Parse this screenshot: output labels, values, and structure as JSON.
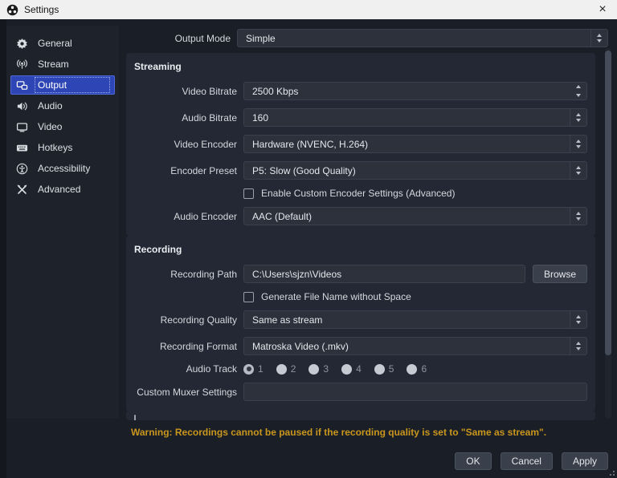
{
  "window": {
    "title": "Settings",
    "close_glyph": "×"
  },
  "sidebar": {
    "selected": "Output",
    "items": [
      {
        "label": "General",
        "icon": "gear-icon"
      },
      {
        "label": "Stream",
        "icon": "broadcast-icon"
      },
      {
        "label": "Output",
        "icon": "output-displays-icon"
      },
      {
        "label": "Audio",
        "icon": "speaker-icon"
      },
      {
        "label": "Video",
        "icon": "monitor-icon"
      },
      {
        "label": "Hotkeys",
        "icon": "keyboard-icon"
      },
      {
        "label": "Accessibility",
        "icon": "accessibility-icon"
      },
      {
        "label": "Advanced",
        "icon": "tools-icon"
      }
    ]
  },
  "output_mode": {
    "label": "Output Mode",
    "value": "Simple"
  },
  "streaming": {
    "title": "Streaming",
    "video_bitrate": {
      "label": "Video Bitrate",
      "value": "2500 Kbps"
    },
    "audio_bitrate": {
      "label": "Audio Bitrate",
      "value": "160"
    },
    "video_encoder": {
      "label": "Video Encoder",
      "value": "Hardware (NVENC, H.264)"
    },
    "encoder_preset": {
      "label": "Encoder Preset",
      "value": "P5: Slow (Good Quality)"
    },
    "custom_encoder_checkbox": {
      "label": "Enable Custom Encoder Settings (Advanced)",
      "checked": false
    },
    "audio_encoder": {
      "label": "Audio Encoder",
      "value": "AAC (Default)"
    }
  },
  "recording": {
    "title": "Recording",
    "path": {
      "label": "Recording Path",
      "value": "C:\\Users\\sjzn\\Videos",
      "browse_label": "Browse"
    },
    "no_space_checkbox": {
      "label": "Generate File Name without Space",
      "checked": false
    },
    "quality": {
      "label": "Recording Quality",
      "value": "Same as stream"
    },
    "format": {
      "label": "Recording Format",
      "value": "Matroska Video (.mkv)"
    },
    "audio_track": {
      "label": "Audio Track",
      "options": [
        "1",
        "2",
        "3",
        "4",
        "5",
        "6"
      ],
      "selected": "1"
    },
    "muxer": {
      "label": "Custom Muxer Settings",
      "value": "",
      "placeholder": ""
    }
  },
  "warning": "Warning: Recordings cannot be paused if the recording quality is set to \"Same as stream\".",
  "footer": {
    "ok": "OK",
    "cancel": "Cancel",
    "apply": "Apply"
  },
  "colors": {
    "accent": "#2e46b5",
    "warning": "#c9961e",
    "titlebar": "#f0f0f0",
    "panel": "#232834",
    "field": "#2c313c"
  }
}
